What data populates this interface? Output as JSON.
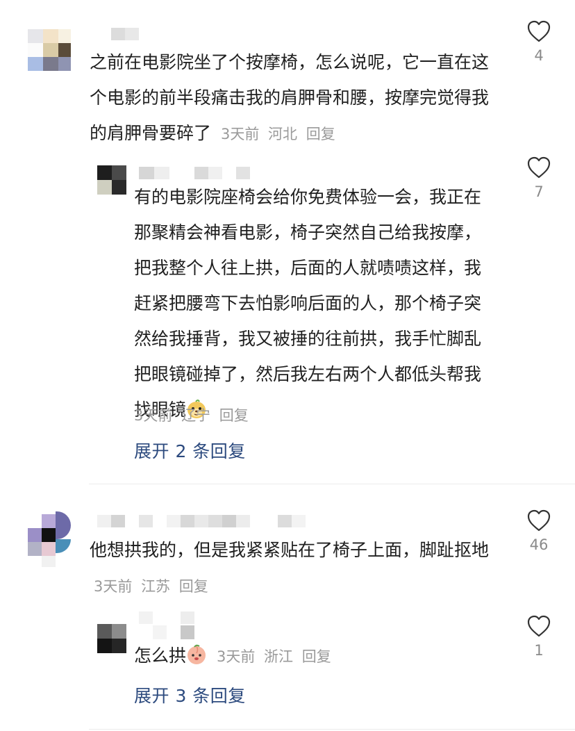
{
  "comments": [
    {
      "text": "之前在电影院坐了个按摩椅，怎么说呢，它一直在这个电影的前半段痛击我的肩胛骨和腰，按摩完觉得我的肩胛骨要碎了",
      "time": "3天前",
      "location": "河北",
      "reply_label": "回复",
      "likes": "4",
      "replies": [
        {
          "text": "有的电影院座椅会给你免费体验一会，我正在那聚精会神看电影，椅子突然自己给我按摩，把我整个人往上拱，后面的人就啧啧这样，我赶紧把腰弯下去怕影响后面的人，那个椅子突然给我捶背，我又被捶的往前拱，我手忙脚乱把眼镜碰掉了，然后我左右两个人都低头帮我找眼镜",
          "emoji": "dog-face-emoji",
          "time": "3天前",
          "location": "辽宁",
          "reply_label": "回复",
          "likes": "7"
        }
      ],
      "expand_label": "展开 2 条回复"
    },
    {
      "text": "他想拱我的，但是我紧紧贴在了椅子上面，脚趾抠地",
      "time": "3天前",
      "location": "江苏",
      "reply_label": "回复",
      "likes": "46",
      "replies": [
        {
          "text": "怎么拱",
          "emoji": "peach-face-emoji",
          "time": "3天前",
          "location": "浙江",
          "reply_label": "回复",
          "likes": "1"
        }
      ],
      "expand_label": "展开 3 条回复"
    }
  ],
  "colors": {
    "link": "#2c4a7e",
    "meta": "#9a9a9a",
    "text": "#1f1f1f"
  }
}
